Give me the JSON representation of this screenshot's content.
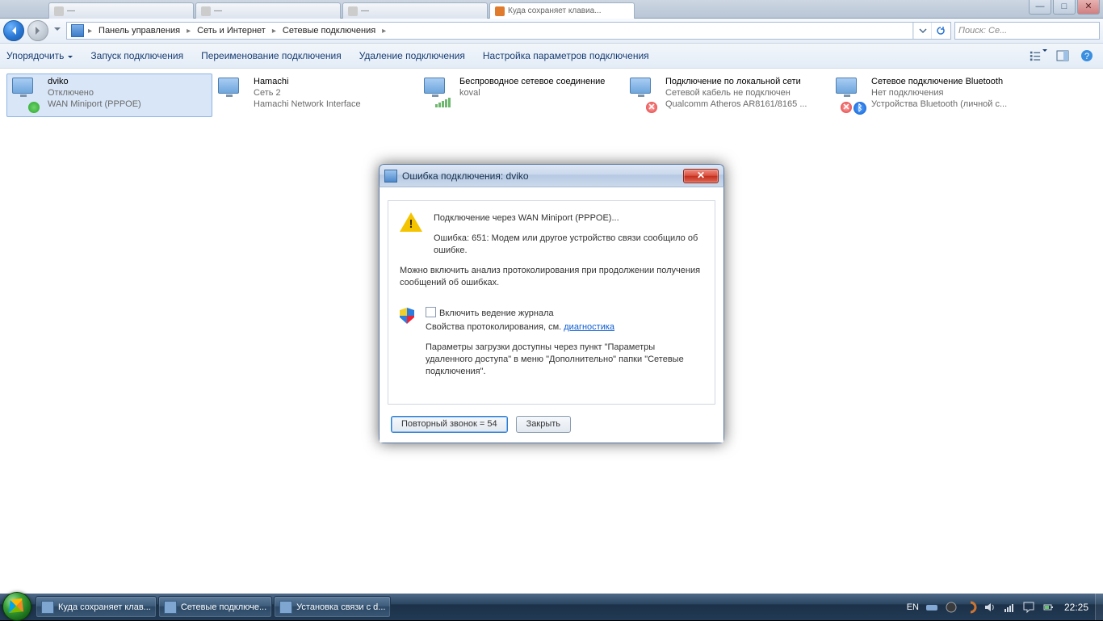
{
  "browser": {
    "tabs": [
      {
        "label": "—"
      },
      {
        "label": "—"
      },
      {
        "label": "—"
      },
      {
        "label": "Куда сохраняет клавиа..."
      }
    ]
  },
  "window_buttons": {
    "min": "—",
    "max": "□",
    "close": "✕"
  },
  "breadcrumb": {
    "items": [
      "Панель управления",
      "Сеть и Интернет",
      "Сетевые подключения"
    ]
  },
  "nav": {
    "refresh_tooltip": "Обновить",
    "dropdown_tooltip": "▾"
  },
  "search": {
    "placeholder": "Поиск: Се..."
  },
  "toolbar": {
    "organize": "Упорядочить",
    "start": "Запуск подключения",
    "rename": "Переименование подключения",
    "delete": "Удаление подключения",
    "settings": "Настройка параметров подключения"
  },
  "connections": [
    {
      "name": "dviko",
      "status": "Отключено",
      "detail": "WAN Miniport (PPPOE)",
      "selected": true,
      "badge": "ok"
    },
    {
      "name": "Hamachi",
      "status": "Сеть 2",
      "detail": "Hamachi Network Interface",
      "badge": "none"
    },
    {
      "name": "Беспроводное сетевое соединение",
      "status": "",
      "detail": "koval",
      "badge": "wifi"
    },
    {
      "name": "Подключение по локальной сети",
      "status": "Сетевой кабель не подключен",
      "detail": "Qualcomm Atheros AR8161/8165 ...",
      "badge": "err"
    },
    {
      "name": "Сетевое подключение Bluetooth",
      "status": "Нет подключения",
      "detail": "Устройства Bluetooth (личной с...",
      "badge": "bt-err"
    }
  ],
  "dialog": {
    "title": "Ошибка подключения: dviko",
    "line1": "Подключение через WAN Miniport (PPPOE)...",
    "error": "Ошибка: 651: Модем или другое устройство связи сообщило об ошибке.",
    "line2": "Можно включить анализ протоколирования при продолжении получения сообщений об ошибках.",
    "checkbox": "Включить ведение журнала",
    "logprops_prefix": "Свойства протоколирования, см. ",
    "logprops_link": "диагностика",
    "line3": "Параметры загрузки доступны через пункт \"Параметры удаленного доступа\" в меню \"Дополнительно\" папки \"Сетевые подключения\".",
    "redial": "Повторный звонок = 54",
    "close": "Закрыть"
  },
  "taskbar": {
    "items": [
      {
        "label": "Куда сохраняет клав..."
      },
      {
        "label": "Сетевые подключе..."
      },
      {
        "label": "Установка связи с d..."
      }
    ],
    "lang": "EN",
    "clock": "22:25"
  }
}
